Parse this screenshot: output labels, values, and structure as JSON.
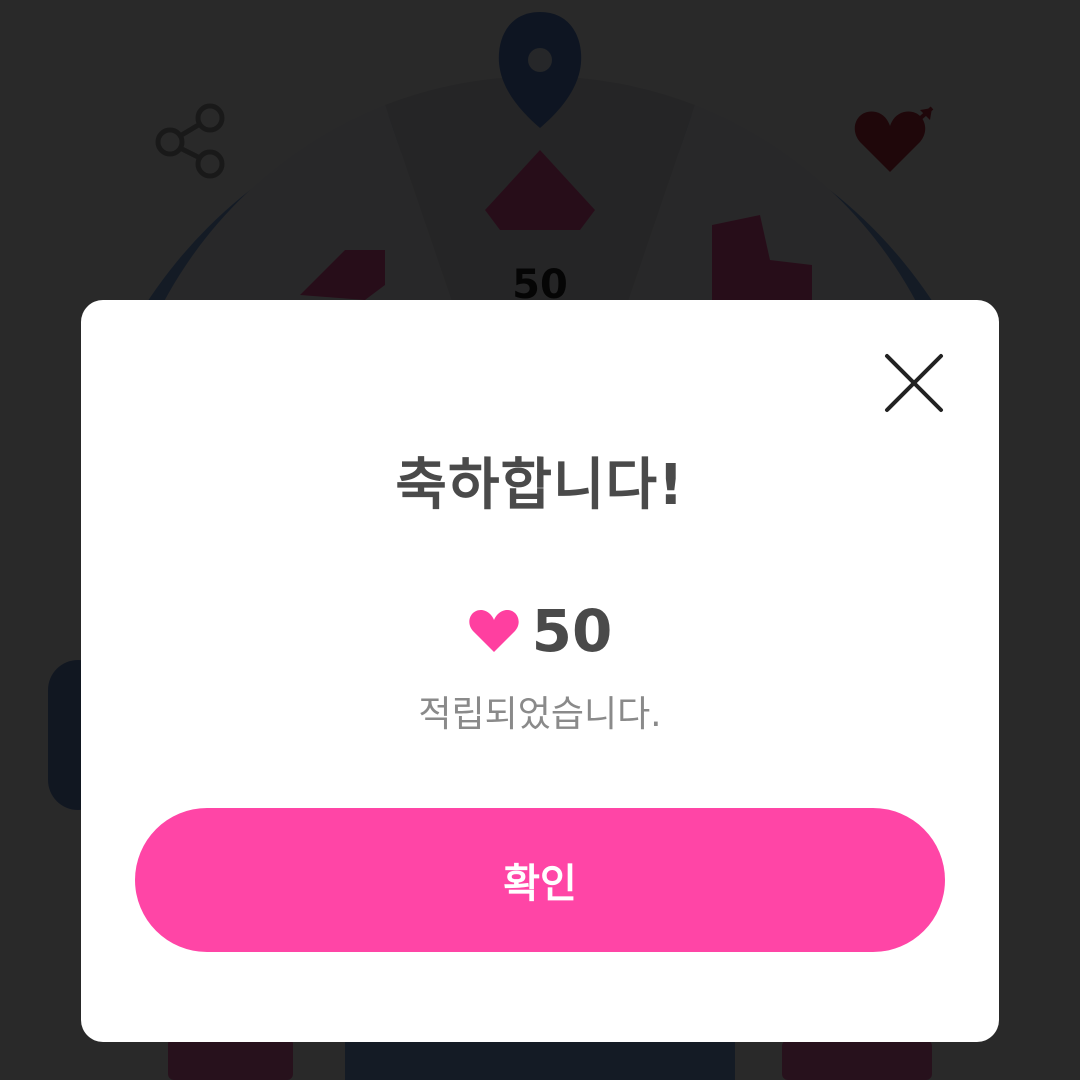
{
  "background": {
    "wheel_segment_value": "50"
  },
  "modal": {
    "title": "축하합니다!",
    "reward_icon": "heart-icon",
    "reward_amount": "50",
    "message": "적립되었습니다.",
    "confirm_label": "확인",
    "close_icon": "close-icon"
  },
  "colors": {
    "accent": "#ff45a6",
    "heart": "#ff3fa0",
    "title_text": "#4a4a4a",
    "sub_text": "#8a8a8a",
    "overlay": "rgba(0,0,0,0.84)",
    "wheel_rim": "#7ea7e6"
  }
}
